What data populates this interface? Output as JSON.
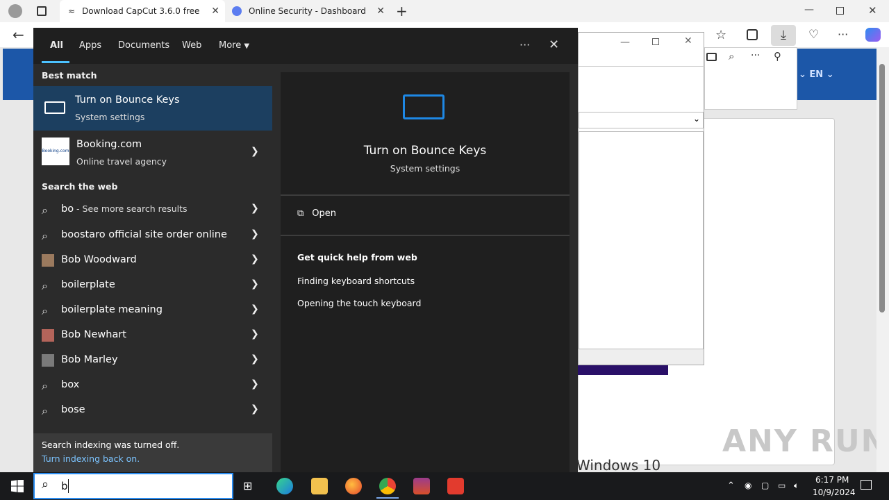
{
  "browser": {
    "tabs": [
      {
        "label": "Download CapCut 3.6.0 free",
        "active": true
      },
      {
        "label": "Online Security - Dashboard",
        "active": false
      }
    ],
    "lang": "EN"
  },
  "search": {
    "tabs": [
      "All",
      "Apps",
      "Documents",
      "Web",
      "More"
    ],
    "active_tab": "All",
    "best_match_header": "Best match",
    "best": {
      "title": "Turn on Bounce Keys",
      "subtitle": "System settings"
    },
    "app": {
      "title": "Booking.com",
      "subtitle": "Online travel agency",
      "logo_text": "Booking.com"
    },
    "web_header": "Search the web",
    "web_results": [
      {
        "text": "bo",
        "suffix": " - See more search results",
        "icon": "search-icon"
      },
      {
        "text": "boostaro official site order online",
        "icon": "search-icon"
      },
      {
        "text": "Bob Woodward",
        "icon": "person-photo"
      },
      {
        "text": "boilerplate",
        "icon": "search-icon"
      },
      {
        "text": "boilerplate meaning",
        "icon": "search-icon"
      },
      {
        "text": "Bob Newhart",
        "icon": "person-photo"
      },
      {
        "text": "Bob Marley",
        "icon": "person-photo"
      },
      {
        "text": "box",
        "icon": "search-icon"
      },
      {
        "text": "bose",
        "icon": "search-icon"
      }
    ],
    "index_notice": "Search indexing was turned off.",
    "index_link": "Turn indexing back on.",
    "preview": {
      "title": "Turn on Bounce Keys",
      "subtitle": "System settings",
      "open_label": "Open",
      "help_header": "Get quick help from web",
      "help_links": [
        "Finding keyboard shortcuts",
        "Opening the touch keyboard"
      ]
    },
    "query": "b"
  },
  "taskbar": {
    "time": "6:17 PM",
    "date": "10/9/2024"
  },
  "background": {
    "windows_text": "Windows 10",
    "watermark": "ANY RUN"
  }
}
